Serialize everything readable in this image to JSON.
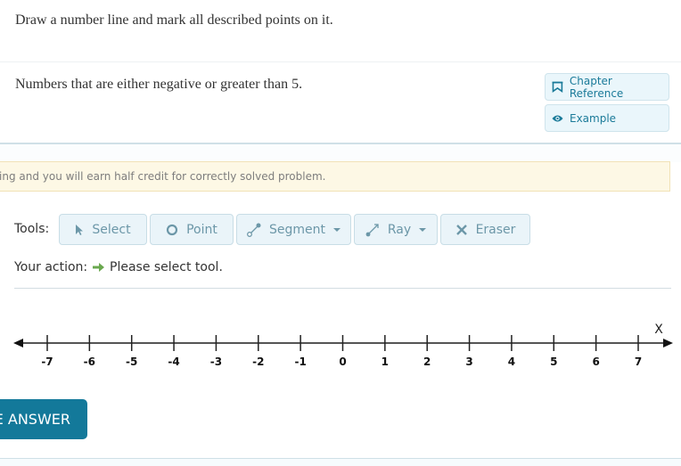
{
  "instruction": "Draw a number line and mark all described points on it.",
  "question": "Numbers that are either negative or greater than 5.",
  "side_buttons": {
    "chapter_reference": "Chapter Reference",
    "example": "Example"
  },
  "warning_text": "ing and you will earn half credit for correctly solved problem.",
  "tools": {
    "label": "Tools:",
    "items": [
      {
        "label": "Select",
        "icon": "cursor-icon",
        "dropdown": false
      },
      {
        "label": "Point",
        "icon": "circle-icon",
        "dropdown": false
      },
      {
        "label": "Segment",
        "icon": "segment-icon",
        "dropdown": true
      },
      {
        "label": "Ray",
        "icon": "ray-icon",
        "dropdown": true
      },
      {
        "label": "Eraser",
        "icon": "x-icon",
        "dropdown": false
      }
    ]
  },
  "action": {
    "label": "Your action:",
    "text": "Please select tool."
  },
  "number_line": {
    "axis_label": "X",
    "min": -7,
    "max": 7,
    "ticks": [
      "-7",
      "-6",
      "-5",
      "-4",
      "-3",
      "-2",
      "-1",
      "0",
      "1",
      "2",
      "3",
      "4",
      "5",
      "6",
      "7"
    ]
  },
  "submit_label": "E ANSWER",
  "colors": {
    "accent": "#13799a",
    "tool_text": "#6c97a8",
    "warning_bg": "#fdf8e5",
    "action_arrow": "#6aa84f"
  }
}
